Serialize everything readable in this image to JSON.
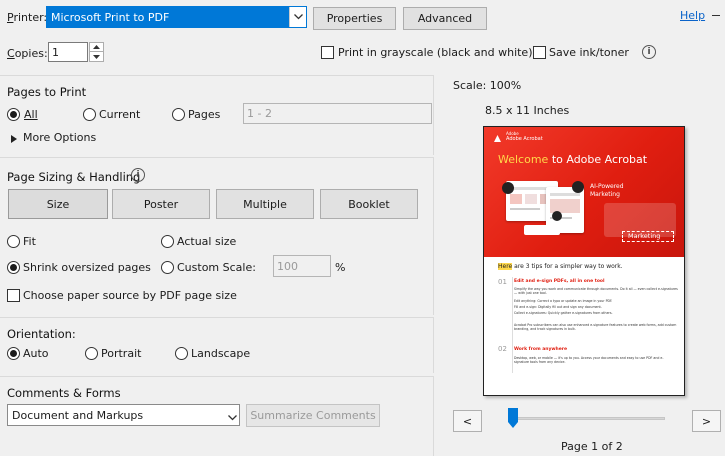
{
  "printer": {
    "label": "Printer:",
    "selected": "Microsoft Print to PDF",
    "properties_label": "Properties",
    "advanced_label": "Advanced",
    "help_label": "Help"
  },
  "copies": {
    "label": "Copies:",
    "value": "1",
    "grayscale_label": "Print in grayscale (black and white)",
    "ink_label": "Save ink/toner"
  },
  "pages_to_print": {
    "title": "Pages to Print",
    "all_label": "All",
    "current_label": "Current",
    "pages_label": "Pages",
    "pages_placeholder": "1 - 2",
    "more_options_label": "More Options",
    "selected": "All"
  },
  "page_sizing": {
    "title": "Page Sizing & Handling",
    "tabs": [
      "Size",
      "Poster",
      "Multiple",
      "Booklet"
    ],
    "fit_label": "Fit",
    "actual_size_label": "Actual size",
    "shrink_label": "Shrink oversized pages",
    "custom_scale_label": "Custom Scale:",
    "custom_scale_value": "100",
    "percent_label": "%",
    "paper_source_label": "Choose paper source by PDF page size",
    "selected": "Shrink oversized pages"
  },
  "orientation": {
    "title": "Orientation:",
    "auto_label": "Auto",
    "portrait_label": "Portrait",
    "landscape_label": "Landscape",
    "selected": "Auto"
  },
  "comments_forms": {
    "title": "Comments & Forms",
    "selected": "Document and Markups",
    "summarize_label": "Summarize Comments"
  },
  "preview": {
    "scale_label": "Scale: 100%",
    "paper_size_label": "8.5 x 11 Inches",
    "page_label": "Page 1 of 2",
    "prev_label": "<",
    "next_label": ">",
    "slider_fraction": 0.0
  },
  "doc": {
    "brand_small": "Adobe",
    "brand": "Adobe Acrobat",
    "headline_highlight": "Welcome",
    "headline_rest": " to Adobe Acrobat",
    "ai_badge_line1": "AI-Powered",
    "ai_badge_line2": "Marketing",
    "marketing_tag": "Marketing",
    "intro_highlight": "Here",
    "intro_rest": " are 3 tips for a simpler way to work.",
    "tip1_num": "01",
    "tip1_title": "Edit and e-sign PDFs, all in one tool",
    "tip1_body": "Simplify the way you work and communicate through documents. Do it all — even collect e-signatures — with just one tool.",
    "tip1_b1": "Edit anything: Correct a typo or update an image in your PDF.",
    "tip1_b2": "Fill and e-sign: Digitally fill out and sign any document.",
    "tip1_b3": "Collect e-signatures: Quickly gather e-signatures from others.",
    "tip1_body2": "Acrobat Pro subscribers can also use enhanced e-signature features to create web forms, add custom branding, and track signatures in bulk.",
    "tip2_num": "02",
    "tip2_title": "Work from anywhere",
    "tip2_body": "Desktop, web, or mobile — it's up to you. Access your documents and easy to use PDF and e-signature tools from any device."
  },
  "colors": {
    "accent_blue": "#0a63c9",
    "adobe_red": "#e01e10",
    "selection_blue": "#0078d7"
  }
}
